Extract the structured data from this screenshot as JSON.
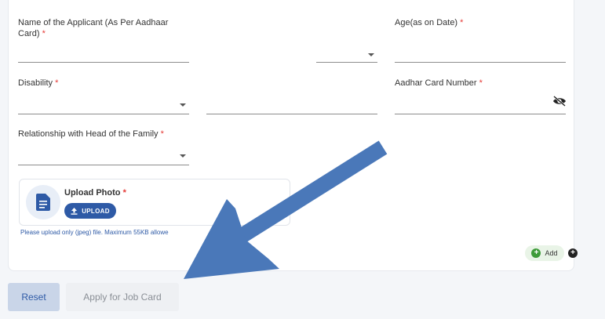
{
  "form": {
    "applicant_name_label": "Name of the Applicant (As Per Aadhaar",
    "applicant_name_label_cont": "Card)",
    "age_label": "Age(as on Date)",
    "disability_label": "Disability",
    "aadhar_label": "Aadhar Card Number",
    "relationship_label": "Relationship with Head of the Family",
    "required_mark": "*"
  },
  "upload": {
    "title": "Upload Photo",
    "button_label": "UPLOAD",
    "hint": "Please upload only (jpeg) file. Maximum 55KB allowe"
  },
  "add_button_label": "Add",
  "buttons": {
    "reset": "Reset",
    "apply": "Apply for Job Card"
  },
  "colors": {
    "primary": "#2e5aa6",
    "required": "#e53935",
    "annotation_arrow": "#4a78b9"
  }
}
